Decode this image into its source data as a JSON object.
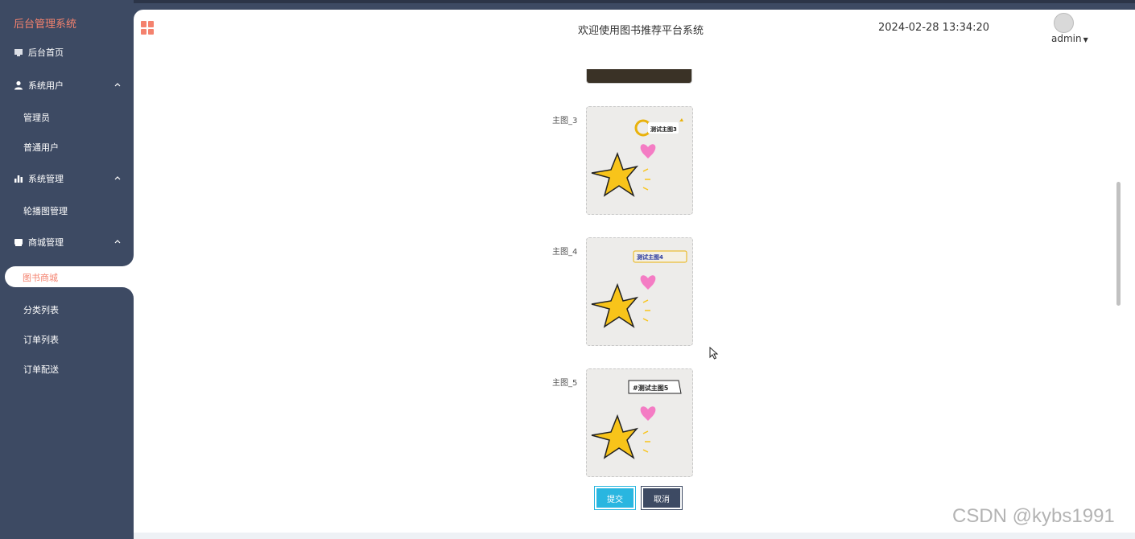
{
  "app": {
    "brand": "后台管理系统",
    "header_title": "欢迎使用图书推荐平台系统",
    "datetime": "2024-02-28 13:34:20",
    "user": "admin",
    "accent": "#f4826e",
    "sidebar_bg": "#3d4a63"
  },
  "sidebar": {
    "items": [
      {
        "label": "后台首页",
        "icon": "monitor-icon"
      },
      {
        "label": "系统用户",
        "icon": "user-icon",
        "expanded": true
      },
      {
        "label": "管理员"
      },
      {
        "label": "普通用户"
      },
      {
        "label": "系统管理",
        "icon": "bar-chart-icon",
        "expanded": true
      },
      {
        "label": "轮播图管理"
      },
      {
        "label": "商城管理",
        "icon": "shop-icon",
        "expanded": true
      },
      {
        "label": "图书商城",
        "active": true
      },
      {
        "label": "分类列表"
      },
      {
        "label": "订单列表"
      },
      {
        "label": "订单配送"
      }
    ]
  },
  "form": {
    "fields": [
      {
        "label": "主图_3",
        "image_text": "测试主图3"
      },
      {
        "label": "主图_4",
        "image_text": "测试主图4"
      },
      {
        "label": "主图_5",
        "image_text": "#测试主图5"
      }
    ],
    "submit_label": "提交",
    "cancel_label": "取消"
  },
  "watermark": "CSDN @kybs1991"
}
